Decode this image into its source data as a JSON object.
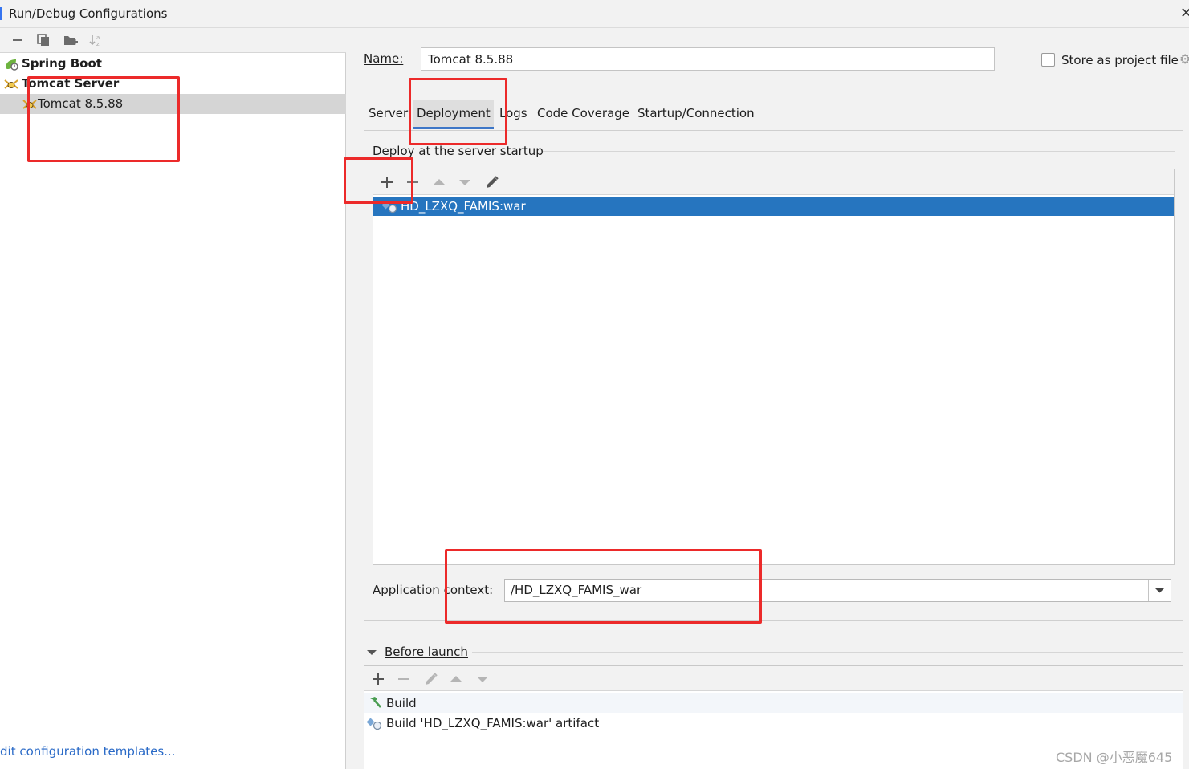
{
  "window": {
    "title": "Run/Debug Configurations"
  },
  "sidebar": {
    "tree": [
      {
        "label": "Spring Boot",
        "icon": "spring-boot-icon",
        "bold": true
      },
      {
        "label": "Tomcat Server",
        "icon": "tomcat-icon",
        "bold": true
      },
      {
        "label": "Tomcat 8.5.88",
        "icon": "tomcat-icon",
        "selected": true
      }
    ],
    "templates_link": "dit configuration templates..."
  },
  "config": {
    "name_label": "Name:",
    "name_value": "Tomcat 8.5.88",
    "store_label": "Store as project file",
    "store_checked": false,
    "tabs": [
      {
        "label": "Server"
      },
      {
        "label": "Deployment",
        "active": true
      },
      {
        "label": "Logs"
      },
      {
        "label": "Code Coverage"
      },
      {
        "label": "Startup/Connection"
      }
    ]
  },
  "deployment": {
    "legend": "Deploy at the server startup",
    "items": [
      {
        "label": "HD_LZXQ_FAMIS:war",
        "selected": true,
        "icon": "artifact-icon"
      }
    ],
    "app_context_label": "Application context:",
    "app_context_value": "/HD_LZXQ_FAMIS_war"
  },
  "before_launch": {
    "legend": "Before launch",
    "items": [
      {
        "label": "Build",
        "icon": "hammer-icon"
      },
      {
        "label": "Build 'HD_LZXQ_FAMIS:war' artifact",
        "icon": "artifact-icon"
      }
    ]
  },
  "watermark": "CSDN @小恶魔645",
  "colors": {
    "selection_blue": "#2675bf",
    "tab_underline": "#3d76c7",
    "annotation_red": "#ec2a2a",
    "link_blue": "#2a6ac7"
  }
}
